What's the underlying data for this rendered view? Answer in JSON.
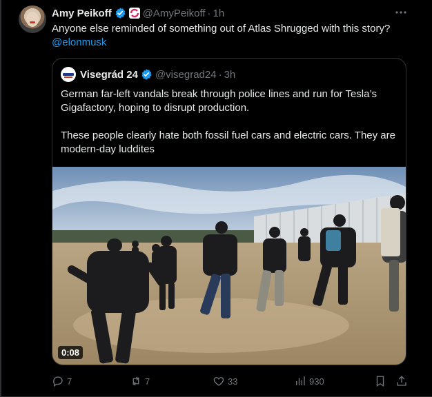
{
  "tweet": {
    "author_name": "Amy Peikoff",
    "handle": "@AmyPeikoff",
    "separator": "·",
    "time": "1h",
    "text": "Anyone else reminded of something out of Atlas Shrugged with this story?",
    "mention": "@elonmusk",
    "more_icon": "ellipsis-icon"
  },
  "quote": {
    "author_name": "Visegrád 24",
    "handle": "@visegrad24",
    "separator": "·",
    "time": "3h",
    "paragraph1": "German far-left vandals break through police lines and run for Tesla’s Gigafactory, hoping to disrupt production.",
    "paragraph2": "These people clearly hate both fossil fuel cars and electric cars. They are modern-day luddites",
    "video_duration": "0:08"
  },
  "actions": {
    "replies": "7",
    "reposts": "7",
    "likes": "33",
    "views": "930"
  },
  "colors": {
    "background": "#000000",
    "text": "#e7e9ea",
    "muted": "#71767b",
    "accent": "#1d9bf0",
    "border": "#2f3336"
  }
}
